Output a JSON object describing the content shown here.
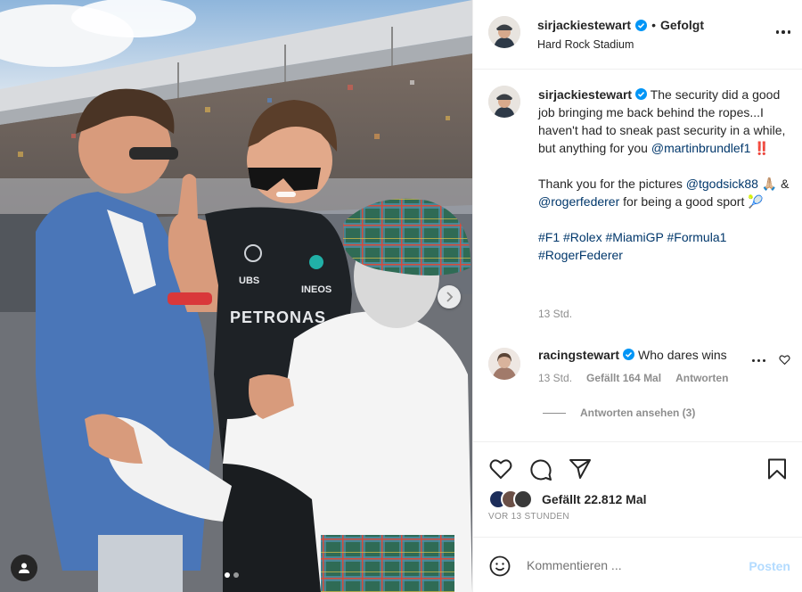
{
  "post": {
    "author": "sirjackiestewart",
    "follow_state": "Gefolgt",
    "separator": "•",
    "location": "Hard Rock Stadium"
  },
  "caption": {
    "username": "sirjackiestewart",
    "line1_text": " The security did a good job bringing me back behind the ropes...I haven't had to sneak past security in a while, but anything for you ",
    "mention1": "@martinbrundlef1",
    "line1_end": " ‼️",
    "line2_text": "Thank you for the pictures ",
    "mention2": "@tgodsick88",
    "line2_mid": " 🙏🏼 & ",
    "mention3": "@rogerfederer",
    "line2_end": " for being a good sport 🎾",
    "hashtags": [
      "#F1",
      "#Rolex",
      "#MiamiGP",
      "#Formula1",
      "#RogerFederer"
    ],
    "time": "13 Std."
  },
  "comment": {
    "username": "racingstewart",
    "text": "Who dares wins",
    "time": "13 Std.",
    "likes": "Gefällt 164 Mal",
    "reply": "Antworten",
    "view_replies": "Antworten ansehen (3)"
  },
  "engagement": {
    "likes": "Gefällt 22.812 Mal",
    "date": "VOR 13 STUNDEN"
  },
  "comment_bar": {
    "placeholder": "Kommentieren ...",
    "post_label": "Posten"
  },
  "photo": {
    "shirt_text": "PETRONAS",
    "sponsor1": "UBS",
    "sponsor2": "INEOS"
  },
  "colors": {
    "verified": "#0095f6",
    "link": "#00376b",
    "post_button": "#b3dbff",
    "secondary_text": "#8e8e8e"
  }
}
